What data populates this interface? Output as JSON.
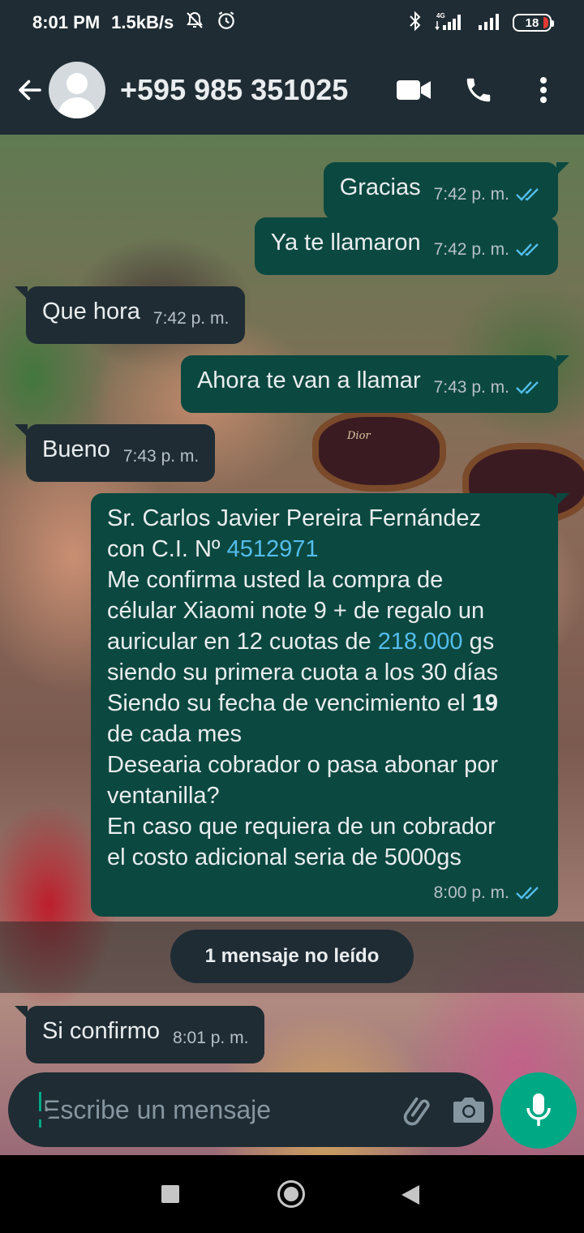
{
  "status_bar": {
    "time": "8:01 PM",
    "speed": "1.5kB/s",
    "battery": "18",
    "icons": [
      "bell-off-icon",
      "alarm-icon",
      "bluetooth-icon",
      "signal-4g-icon",
      "signal-icon",
      "battery-icon"
    ]
  },
  "header": {
    "contact": "+595 985 351025",
    "icons": [
      "back-arrow-icon",
      "default-avatar-icon",
      "video-call-icon",
      "phone-icon",
      "more-vert-icon"
    ]
  },
  "messages": [
    {
      "direction": "out",
      "text": "Gracias",
      "time": "7:42 p. m.",
      "read": true
    },
    {
      "direction": "out",
      "text": "Ya te llamaron",
      "time": "7:42 p. m.",
      "read": true
    },
    {
      "direction": "in",
      "text": "Que hora",
      "time": "7:42 p. m."
    },
    {
      "direction": "out",
      "text": "Ahora te van a llamar",
      "time": "7:43 p. m.",
      "read": true
    },
    {
      "direction": "in",
      "text": "Bueno",
      "time": "7:43 p. m."
    }
  ],
  "long_message": {
    "line1": "Sr. Carlos Javier Pereira Fernández",
    "line2_prefix": "con C.I. Nº ",
    "ci_number": "4512971",
    "line3": "Me confirma usted la compra de",
    "line4": "célular Xiaomi note 9 + de regalo un",
    "line5_prefix": "auricular en 12 cuotas de ",
    "amount": "218.000",
    "line5_suffix": " gs",
    "line6": "siendo su primera cuota a los 30 días",
    "line7_prefix": "Siendo su fecha de vencimiento el ",
    "due_day": "19",
    "line8": "de cada mes",
    "line9": "Desearia cobrador o pasa abonar por",
    "line10": "ventanilla?",
    "line11": "En caso que requiera de un cobrador",
    "line12": "el costo adicional seria de 5000gs",
    "time": "8:00 p. m.",
    "read": true
  },
  "unread_label": "1 mensaje no leído",
  "last_message": {
    "direction": "in",
    "text": "Si confirmo",
    "time": "8:01 p. m."
  },
  "wallpaper_logo": "Dior",
  "input": {
    "placeholder": "Escribe un mensaje",
    "value": "",
    "icons": [
      "emoji-icon",
      "attach-icon",
      "camera-icon",
      "mic-icon"
    ]
  },
  "colors": {
    "bar_bg": "#1f2c34",
    "outgoing_bubble": "#0b4840",
    "incoming_bubble": "#1f2c34",
    "link": "#53bdeb",
    "read_ticks": "#53bdeb",
    "accent": "#00a884"
  }
}
